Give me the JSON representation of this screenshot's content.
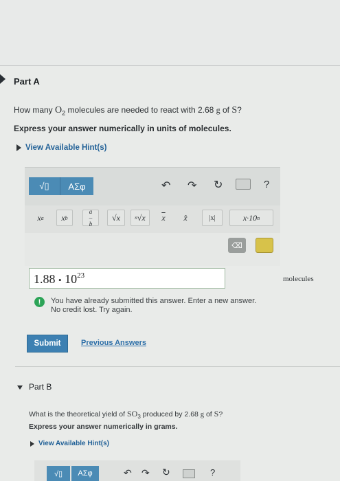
{
  "partA": {
    "title": "Part A",
    "question": {
      "prefix": "How many ",
      "molecule": "O",
      "molecule_sub": "2",
      "middle": " molecules are needed to react with ",
      "mass": "2.68",
      "unit": "g",
      "of": " of ",
      "element": "S",
      "qmark": "?"
    },
    "instruction": "Express your answer numerically in units of molecules.",
    "hint_label": "View Available Hint(s)",
    "toolbar": {
      "templates_label": "√▯",
      "symbols_label": "ΑΣφ",
      "help_label": "?"
    },
    "templates": [
      "xa",
      "xb",
      "a/b",
      "√x",
      "ⁿ√x",
      "x̄",
      "x̂",
      "|x|",
      "x·10ⁿ"
    ],
    "answer": {
      "mantissa": "1.88",
      "dot": "•",
      "base": "10",
      "exponent": "23"
    },
    "unit_label": "molecules",
    "feedback": {
      "line1": "You have already submitted this answer. Enter a new answer.",
      "line2": "No credit lost. Try again."
    },
    "submit_label": "Submit",
    "previous_label": "Previous Answers"
  },
  "partB": {
    "title": "Part B",
    "question": {
      "prefix": "What is the theoretical yield of ",
      "molecule": "SO",
      "molecule_sub": "3",
      "middle": " produced by ",
      "mass": "2.68",
      "unit": "g",
      "of": " of ",
      "element": "S",
      "qmark": "?"
    },
    "instruction": "Express your answer numerically in grams.",
    "hint_label": "View Available Hint(s)",
    "toolbar": {
      "templates_label": "√▯",
      "symbols_label": "ΑΣφ",
      "help_label": "?"
    }
  },
  "colors": {
    "accent": "#4b8bb5",
    "link": "#2d6fa8",
    "success": "#2ca457"
  }
}
